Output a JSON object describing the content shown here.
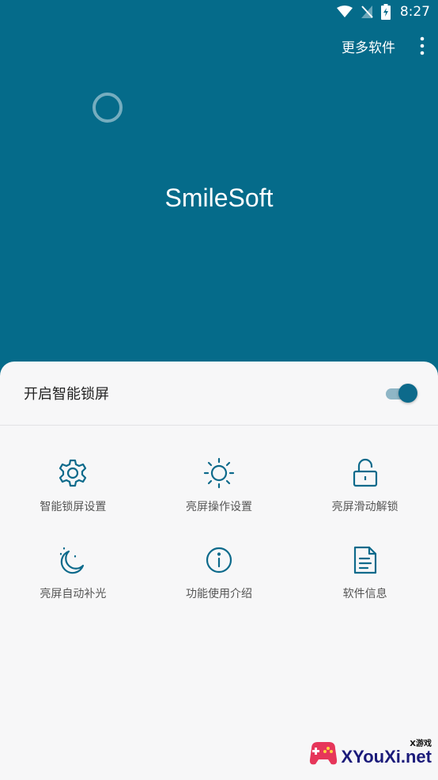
{
  "status_bar": {
    "time": "8:27",
    "icons": [
      "wifi-icon",
      "signal-off-icon",
      "battery-charging-icon"
    ]
  },
  "app_bar": {
    "more_label": "更多软件",
    "overflow_icon": "more-vert-icon"
  },
  "hero": {
    "title": "SmileSoft"
  },
  "sheet": {
    "toggle": {
      "label": "开启智能锁屏",
      "enabled": true
    },
    "items": [
      {
        "icon": "gear-icon",
        "label": "智能锁屏设置"
      },
      {
        "icon": "sun-icon",
        "label": "亮屏操作设置"
      },
      {
        "icon": "unlock-icon",
        "label": "亮屏滑动解锁"
      },
      {
        "icon": "moon-icon",
        "label": "亮屏自动补光"
      },
      {
        "icon": "info-icon",
        "label": "功能使用介绍"
      },
      {
        "icon": "document-icon",
        "label": "软件信息"
      }
    ]
  },
  "watermark": {
    "small": "X游戏",
    "big": "XYouXi.net"
  },
  "colors": {
    "primary": "#056b8a",
    "accent": "#0d6a8b",
    "sheet_bg": "#f7f7f8"
  }
}
